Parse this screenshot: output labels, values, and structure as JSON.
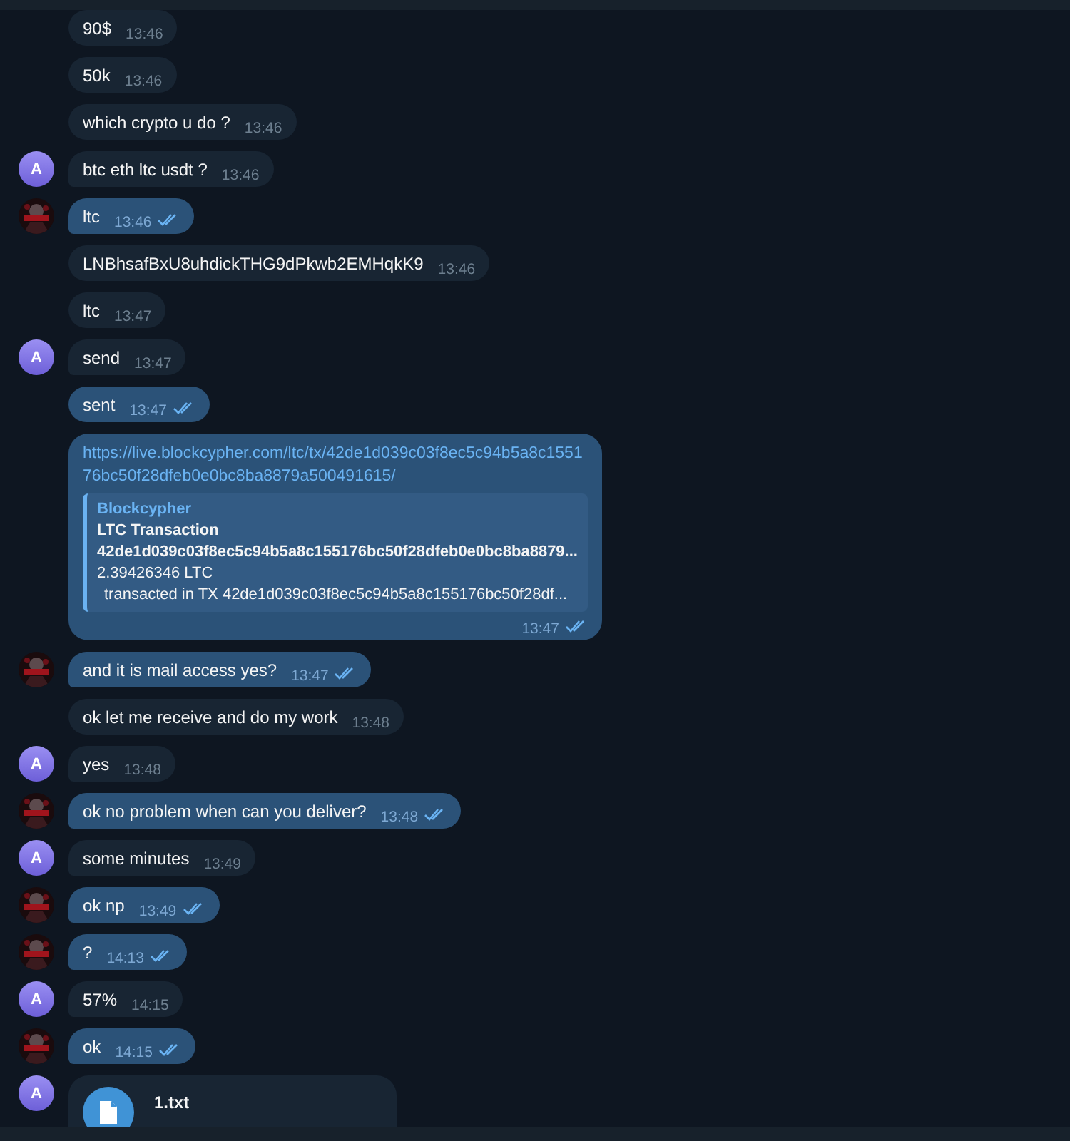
{
  "messages": [
    {
      "kind": "text",
      "outgoing": false,
      "text": "90$",
      "time": "13:46"
    },
    {
      "kind": "text",
      "outgoing": false,
      "text": "50k",
      "time": "13:46"
    },
    {
      "kind": "text",
      "outgoing": false,
      "text": "which crypto u do ?",
      "time": "13:46"
    },
    {
      "kind": "text",
      "outgoing": false,
      "avatar": {
        "kind": "letter",
        "initial": "A"
      },
      "text": "btc eth ltc usdt ?",
      "time": "13:46"
    },
    {
      "kind": "text",
      "outgoing": true,
      "read": true,
      "text": "ltc",
      "time": "13:46"
    },
    {
      "kind": "text",
      "outgoing": false,
      "text": "LNBhsafBxU8uhdickTHG9dPkwb2EMHqkK9",
      "time": "13:46"
    },
    {
      "kind": "text",
      "outgoing": false,
      "text": "ltc",
      "time": "13:47"
    },
    {
      "kind": "text",
      "outgoing": false,
      "avatar": {
        "kind": "letter",
        "initial": "A"
      },
      "text": "send",
      "time": "13:47"
    },
    {
      "kind": "text",
      "outgoing": true,
      "read": true,
      "text": "sent",
      "time": "13:47"
    },
    {
      "kind": "link",
      "outgoing": true,
      "read": true,
      "url": "https://live.blockcypher.com/ltc/tx/42de1d039c03f8ec5c94b5a8c155176bc50f28dfeb0e0bc8ba8879a500491615/",
      "preview": {
        "site": "Blockcypher",
        "title": [
          "LTC Transaction",
          "42de1d039c03f8ec5c94b5a8c155176bc50f28dfeb0e0bc8ba8879..."
        ],
        "description": [
          "2.39426346 LTC",
          "transacted in TX 42de1d039c03f8ec5c94b5a8c155176bc50f28df..."
        ]
      },
      "time": "13:47"
    },
    {
      "kind": "text",
      "outgoing": true,
      "read": true,
      "text": "and it is mail access yes?",
      "time": "13:47"
    },
    {
      "kind": "text",
      "outgoing": false,
      "text": "ok let me receive and do my work",
      "time": "13:48"
    },
    {
      "kind": "text",
      "outgoing": false,
      "avatar": {
        "kind": "letter",
        "initial": "A"
      },
      "text": "yes",
      "time": "13:48"
    },
    {
      "kind": "text",
      "outgoing": true,
      "read": true,
      "text": "ok no problem when can you deliver?",
      "time": "13:48"
    },
    {
      "kind": "text",
      "outgoing": false,
      "avatar": {
        "kind": "letter",
        "initial": "A"
      },
      "text": "some minutes",
      "time": "13:49"
    },
    {
      "kind": "text",
      "outgoing": true,
      "read": true,
      "text": "ok np",
      "time": "13:49"
    },
    {
      "kind": "text",
      "outgoing": true,
      "read": true,
      "text": "?",
      "time": "14:13"
    },
    {
      "kind": "text",
      "outgoing": false,
      "avatar": {
        "kind": "letter",
        "initial": "A"
      },
      "text": "57%",
      "time": "14:15"
    },
    {
      "kind": "text",
      "outgoing": true,
      "read": true,
      "text": "ok",
      "time": "14:15"
    },
    {
      "kind": "file",
      "outgoing": false,
      "avatar": {
        "kind": "letter",
        "initial": "A"
      },
      "name": "1.txt"
    }
  ]
}
